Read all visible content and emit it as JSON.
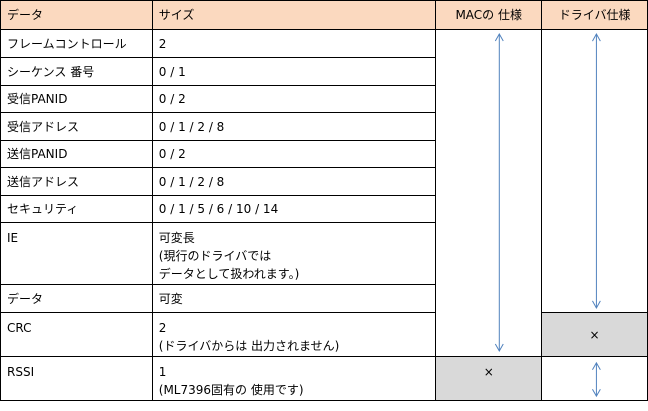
{
  "table": {
    "headers": [
      "データ",
      "サイズ",
      "MACの 仕様",
      "ドライバ仕様"
    ],
    "rows": [
      {
        "data": "フレームコントロール",
        "size": "2"
      },
      {
        "data": "シーケンス 番号",
        "size": "0 / 1"
      },
      {
        "data": "受信PANID",
        "size": "0 / 2"
      },
      {
        "data": "受信アドレス",
        "size": "0 / 1 / 2 / 8"
      },
      {
        "data": "送信PANID",
        "size": "0 / 2"
      },
      {
        "data": "送信アドレス",
        "size": "0 / 1 / 2 / 8"
      },
      {
        "data": "セキュリティ",
        "size": "0 / 1 / 5 / 6 / 10 / 14"
      },
      {
        "data": "IE",
        "size": "可変長\n (現行のドライバでは\nデータとして扱われます。)"
      },
      {
        "data": "データ",
        "size": "可変"
      },
      {
        "data": "CRC",
        "size": "2\n(ドライバからは 出力されません)"
      },
      {
        "data": "RSSI",
        "size": "1\n(ML7396固有の 使用です)"
      }
    ],
    "marks": {
      "driver_crc": "×",
      "mac_rssi": "×"
    }
  },
  "colors": {
    "header_bg": "#fbd9bf",
    "shade_bg": "#d9d9d9",
    "arrow": "#4f81bd",
    "border": "#000000"
  }
}
